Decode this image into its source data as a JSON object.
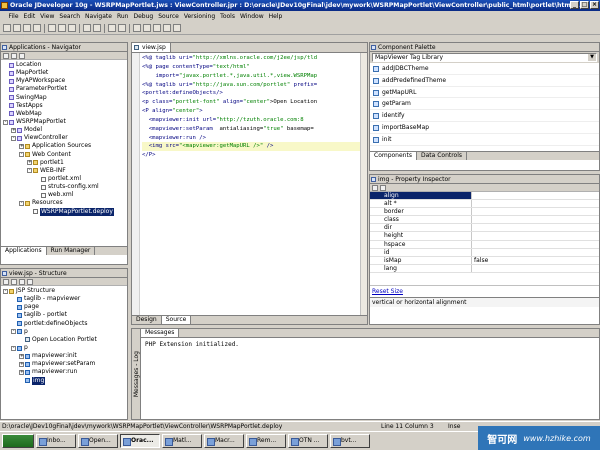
{
  "window": {
    "title": "Oracle JDeveloper 10g - WSRPMapPortlet.jws : ViewController.jpr : D:\\oracle\\JDev10gFinal\\jdev\\mywork\\WSRPMapPortlet\\ViewController\\public_html\\portlet\\html\\..."
  },
  "menu": [
    "File",
    "Edit",
    "View",
    "Search",
    "Navigate",
    "Run",
    "Debug",
    "Source",
    "Versioning",
    "Tools",
    "Window",
    "Help"
  ],
  "navigator": {
    "title": "Applications - Navigator",
    "items": [
      {
        "label": "Location",
        "depth": 0,
        "icon": "project",
        "expander": ""
      },
      {
        "label": "MapPortlet",
        "depth": 0,
        "icon": "project",
        "expander": ""
      },
      {
        "label": "MyAPWorkspace",
        "depth": 0,
        "icon": "project",
        "expander": ""
      },
      {
        "label": "ParameterPortlet",
        "depth": 0,
        "icon": "project",
        "expander": ""
      },
      {
        "label": "SwingMap",
        "depth": 0,
        "icon": "project",
        "expander": ""
      },
      {
        "label": "TestApps",
        "depth": 0,
        "icon": "project",
        "expander": ""
      },
      {
        "label": "WebMap",
        "depth": 0,
        "icon": "project",
        "expander": ""
      },
      {
        "label": "WSRPMapPortlet",
        "depth": 0,
        "icon": "project",
        "expander": "-"
      },
      {
        "label": "Model",
        "depth": 1,
        "icon": "project",
        "expander": "+"
      },
      {
        "label": "ViewController",
        "depth": 1,
        "icon": "project",
        "expander": "-"
      },
      {
        "label": "Application Sources",
        "depth": 2,
        "icon": "folder",
        "expander": "+"
      },
      {
        "label": "Web Content",
        "depth": 2,
        "icon": "folder",
        "expander": "-"
      },
      {
        "label": "portlet1",
        "depth": 3,
        "icon": "folder",
        "expander": "+"
      },
      {
        "label": "WEB-INF",
        "depth": 3,
        "icon": "folder",
        "expander": "-"
      },
      {
        "label": "portlet.xml",
        "depth": 4,
        "icon": "file",
        "expander": ""
      },
      {
        "label": "struts-config.xml",
        "depth": 4,
        "icon": "file",
        "expander": ""
      },
      {
        "label": "web.xml",
        "depth": 4,
        "icon": "file",
        "expander": ""
      },
      {
        "label": "Resources",
        "depth": 2,
        "icon": "folder",
        "expander": "-"
      },
      {
        "label": "WSRPMapPortlet.deploy",
        "depth": 3,
        "icon": "file",
        "expander": "",
        "selected": true
      }
    ],
    "tabs": [
      "Applications",
      "Run Manager"
    ]
  },
  "structure": {
    "title": "view.jsp - Structure",
    "items": [
      {
        "label": "JSP Structure",
        "depth": 0,
        "icon": "folder",
        "expander": "-"
      },
      {
        "label": "taglib - mapviewer",
        "depth": 1,
        "icon": "tag",
        "expander": ""
      },
      {
        "label": "page",
        "depth": 1,
        "icon": "tag",
        "expander": ""
      },
      {
        "label": "taglib - portlet",
        "depth": 1,
        "icon": "tag",
        "expander": ""
      },
      {
        "label": "portlet:defineObjects",
        "depth": 1,
        "icon": "tag",
        "expander": ""
      },
      {
        "label": "p",
        "depth": 1,
        "icon": "tag",
        "expander": "-"
      },
      {
        "label": "Open Location Portlet",
        "depth": 2,
        "icon": "page",
        "expander": ""
      },
      {
        "label": "p",
        "depth": 1,
        "icon": "tag",
        "expander": "-"
      },
      {
        "label": "mapviewer:init",
        "depth": 2,
        "icon": "tag",
        "expander": "+"
      },
      {
        "label": "mapviewer:setParam",
        "depth": 2,
        "icon": "tag",
        "expander": "+"
      },
      {
        "label": "mapviewer:run",
        "depth": 2,
        "icon": "tag",
        "expander": "+"
      },
      {
        "label": "img",
        "depth": 2,
        "icon": "tag",
        "expander": "",
        "selected": true
      }
    ]
  },
  "editor": {
    "tab": "view.jsp",
    "lines": [
      [
        {
          "c": "c-tag",
          "t": "<%@ taglib uri="
        },
        {
          "c": "c-str",
          "t": "\"http://xmlns.oracle.com/j2ee/jsp/tld"
        }
      ],
      [
        {
          "c": "c-tag",
          "t": "<%@ page contentType="
        },
        {
          "c": "c-str",
          "t": "\"text/html\""
        }
      ],
      [
        {
          "c": "c-tag",
          "t": "    import="
        },
        {
          "c": "c-str",
          "t": "\"javax.portlet.*,java.util.*,view.WSRPMap"
        }
      ],
      [
        {
          "c": "c-tag",
          "t": "<%@ taglib uri="
        },
        {
          "c": "c-str",
          "t": "\"http://java.sun.com/portlet\""
        },
        {
          "c": "c-tag",
          "t": " prefix="
        }
      ],
      [
        {
          "c": "c-tag",
          "t": "<portlet:defineObjects/>"
        }
      ],
      [
        {
          "c": "c-tag",
          "t": "<p class="
        },
        {
          "c": "c-str",
          "t": "\"portlet-font\""
        },
        {
          "c": "c-tag",
          "t": " align="
        },
        {
          "c": "c-str",
          "t": "\"center\""
        },
        {
          "c": "",
          "t": ">Open Location"
        }
      ],
      [
        {
          "c": "c-tag",
          "t": "<P align="
        },
        {
          "c": "c-str",
          "t": "\"center\""
        },
        {
          "c": "c-tag",
          "t": ">"
        }
      ],
      [
        {
          "c": "c-tag",
          "t": "  <mapviewer:init url="
        },
        {
          "c": "c-str",
          "t": "\"http://tzuth.oracle.com:8"
        }
      ],
      [
        {
          "c": "c-tag",
          "t": "  <mapviewer:setParam"
        },
        {
          "c": "",
          "t": "  antialiasing="
        },
        {
          "c": "c-str",
          "t": "\"true\""
        },
        {
          "c": "",
          "t": " basemap="
        }
      ],
      [
        {
          "c": "c-tag",
          "t": "  <mapviewer:run />"
        }
      ],
      [
        {
          "c": "c-tag",
          "t": "  <img src="
        },
        {
          "c": "c-str",
          "t": "\"<mapviewer:getMapURL />\""
        },
        {
          "c": "c-tag",
          "t": " />"
        }
      ],
      [
        {
          "c": "c-tag",
          "t": "</P>"
        }
      ]
    ],
    "bottom_tabs": [
      "Design",
      "Source"
    ]
  },
  "palette": {
    "title": "Component Palette",
    "library": "MapViewer Tag Library",
    "items": [
      "addJDBCTheme",
      "addPredefinedTheme",
      "getMapURL",
      "getParam",
      "identify",
      "importBaseMap",
      "init"
    ],
    "tabs": [
      "Components",
      "Data Controls"
    ]
  },
  "inspector": {
    "title": "img - Property Inspector",
    "rows": [
      {
        "key": "align",
        "value": ""
      },
      {
        "key": "alt *",
        "value": ""
      },
      {
        "key": "border",
        "value": ""
      },
      {
        "key": "class",
        "value": ""
      },
      {
        "key": "dir",
        "value": ""
      },
      {
        "key": "height",
        "value": ""
      },
      {
        "key": "hspace",
        "value": ""
      },
      {
        "key": "id",
        "value": ""
      },
      {
        "key": "isMap",
        "value": "false"
      },
      {
        "key": "lang",
        "value": ""
      }
    ],
    "reset": "Reset Size",
    "description": "vertical or horizontal alignment"
  },
  "messages": {
    "tab": "Messages",
    "side_tab": "Messages - Log",
    "text": "PHP Extension initialized."
  },
  "status": {
    "path": "D:\\oracle\\JDev10gFinal\\jdev\\mywork\\WSRPMapPortlet\\ViewController\\WSRPMapPortlet.deploy",
    "position": "Line 11 Column 3",
    "mode": "Inse"
  },
  "taskbar": {
    "items": [
      "Inbo...",
      "Open...",
      "Orac...",
      "Matl...",
      "Macr...",
      "Rem...",
      "OTN ...",
      "bvt..."
    ],
    "active_index": 2
  },
  "watermark": {
    "cn": "智可网",
    "url": "www.hzhike.com"
  },
  "colors": {
    "accent": "#0a246a",
    "title_bar": "#1a4fb8",
    "chrome": "#d4d0c8"
  }
}
